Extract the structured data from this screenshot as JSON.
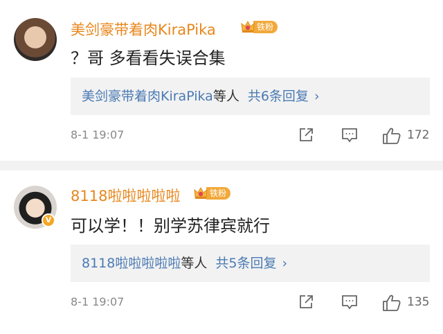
{
  "comments": [
    {
      "username": "美剑豪带着肉KiraPika",
      "fan_badge": "铁粉",
      "text": "？哥 多看看失误合集",
      "reply_user": "美剑豪带着肉KiraPika",
      "reply_etc": "等人",
      "reply_count": "共6条回复",
      "reply_chevron": "›",
      "time": "8-1 19:07",
      "likes": "172"
    },
    {
      "username": "8118啦啦啦啦啦",
      "fan_badge": "铁粉",
      "verified": true,
      "text": "可以学！！别学苏律宾就行",
      "reply_user": "8118啦啦啦啦啦",
      "reply_etc": "等人",
      "reply_count": "共5条回复",
      "reply_chevron": "›",
      "time": "8-1 19:07",
      "likes": "135"
    }
  ],
  "colors": {
    "username": "#e8861c",
    "reply_link": "#4a7ab3",
    "fan_badge": "#f2a93b",
    "reply_bg": "#f2f2f2"
  },
  "icons": [
    "share-icon",
    "comment-icon",
    "like-icon",
    "crown-icon",
    "verified-badge-icon"
  ]
}
